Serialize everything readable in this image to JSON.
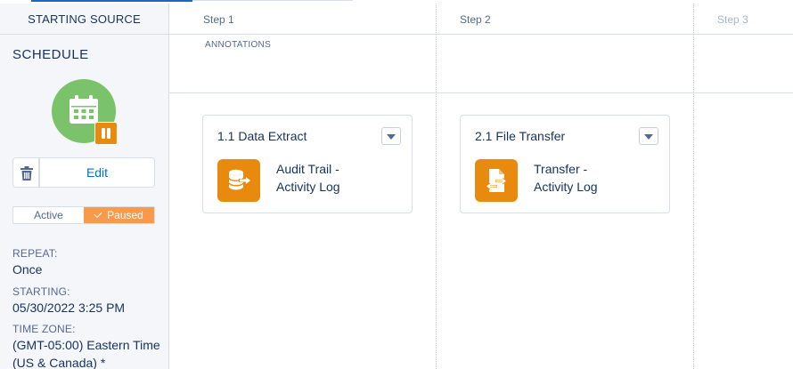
{
  "sidebar": {
    "header": "STARTING SOURCE",
    "title": "SCHEDULE",
    "edit_label": "Edit",
    "toggle": {
      "active_label": "Active",
      "paused_label": "Paused",
      "selected": "Paused"
    },
    "repeat_label": "REPEAT:",
    "repeat_value": "Once",
    "starting_label": "STARTING:",
    "starting_value": "05/30/2022 3:25 PM",
    "timezone_label": "TIME ZONE:",
    "timezone_line1": "(GMT-05:00) Eastern Time",
    "timezone_line2": "(US & Canada) *"
  },
  "steps": [
    {
      "label": "Step 1"
    },
    {
      "label": "Step 2"
    },
    {
      "label": "Step 3"
    }
  ],
  "annotations_label": "ANNOTATIONS",
  "cards": [
    {
      "title": "1.1 Data Extract",
      "line1": "Audit Trail -",
      "line2": "Activity Log",
      "icon": "database-export-icon"
    },
    {
      "title": "2.1 File Transfer",
      "line1": "Transfer -",
      "line2": "Activity Log",
      "icon": "file-transfer-icon"
    }
  ],
  "colors": {
    "accent_orange": "#e88a0d",
    "schedule_green": "#7bc36a",
    "paused_orange": "#f79a4b",
    "link_blue": "#0070d2",
    "text_navy": "#16325c"
  }
}
